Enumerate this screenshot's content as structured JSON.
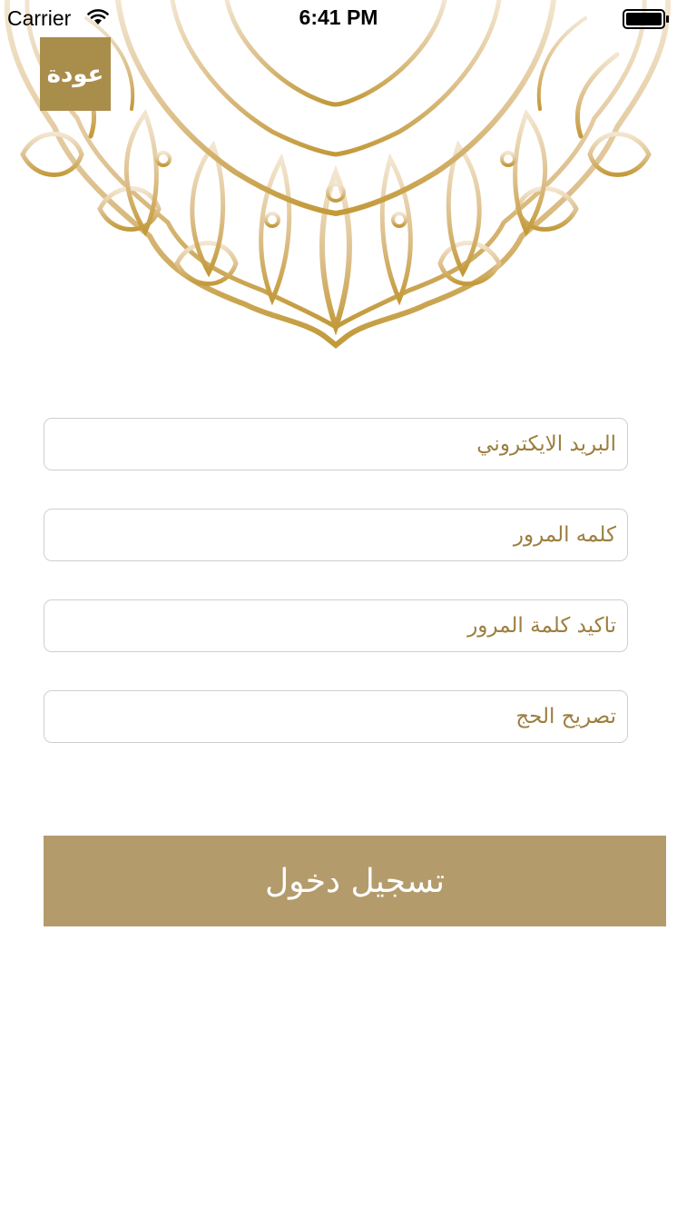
{
  "status_bar": {
    "carrier": "Carrier",
    "time": "6:41 PM",
    "wifi_icon": "wifi-icon",
    "battery_icon": "battery-icon"
  },
  "header": {
    "back_label": "عودة",
    "ornament": "mandala-ornament"
  },
  "form": {
    "email_placeholder": "البريد الايكتروني",
    "password_placeholder": "كلمه المرور",
    "confirm_password_placeholder": "تاكيد كلمة المرور",
    "hajj_permit_placeholder": "تصريح الحج",
    "submit_label": "تسجيل دخول"
  },
  "colors": {
    "accent_gold": "#a98d4b",
    "button_gold": "#b39b6b",
    "placeholder_gold": "#9c7e3e",
    "field_border": "#cfcfcf"
  }
}
